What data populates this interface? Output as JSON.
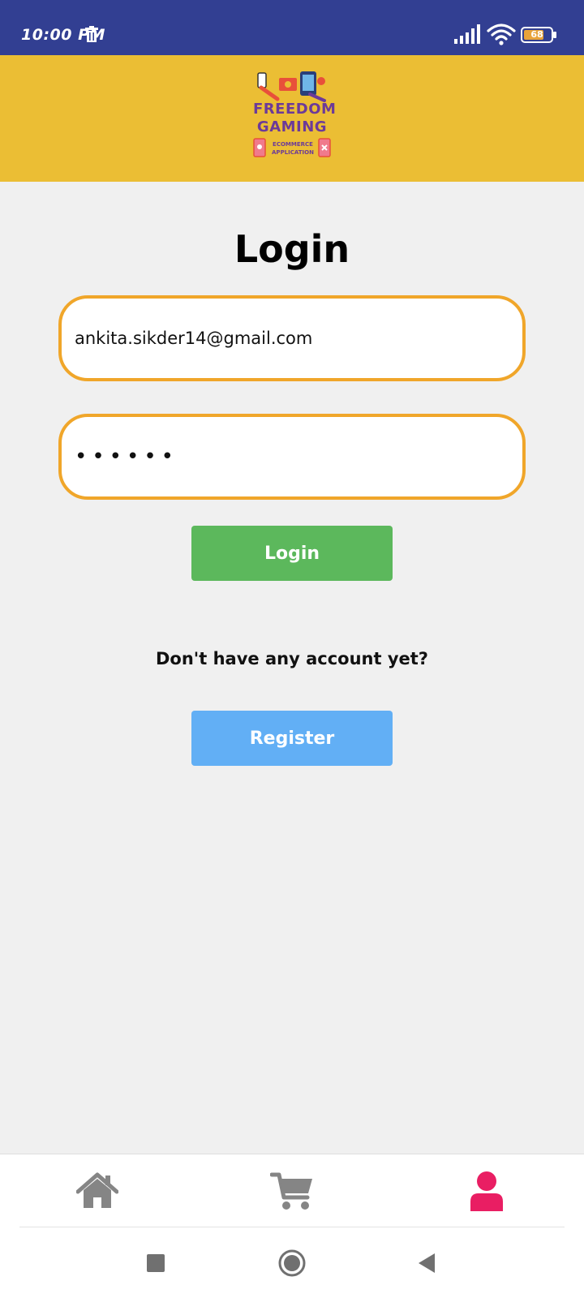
{
  "status_bar": {
    "time": "10:00 PM",
    "battery_level": "68",
    "icons": [
      "trash-icon",
      "signal-icon",
      "wifi-icon",
      "battery-icon"
    ]
  },
  "header": {
    "logo_line1": "FREEDOM",
    "logo_line2": "GAMING",
    "logo_sub1": "ECOMMERCE",
    "logo_sub2": "APPLICATION"
  },
  "login_form": {
    "title": "Login",
    "email_value": "ankita.sikder14@gmail.com",
    "password_value": "••••••",
    "login_button_label": "Login",
    "account_prompt": "Don't have any account yet?",
    "register_button_label": "Register"
  },
  "bottom_nav": {
    "items": [
      {
        "icon": "home-icon",
        "active": false
      },
      {
        "icon": "cart-icon",
        "active": false
      },
      {
        "icon": "user-icon",
        "active": true
      }
    ]
  },
  "system_nav": {
    "buttons": [
      "recent-apps-icon",
      "home-circle-icon",
      "back-icon"
    ]
  },
  "colors": {
    "status_bar": "#323f92",
    "header": "#ebbe34",
    "field_border": "#f0a62a",
    "login_button": "#5cb85c",
    "register_button": "#62aff5",
    "nav_inactive": "#858585",
    "nav_active": "#e91e63"
  }
}
